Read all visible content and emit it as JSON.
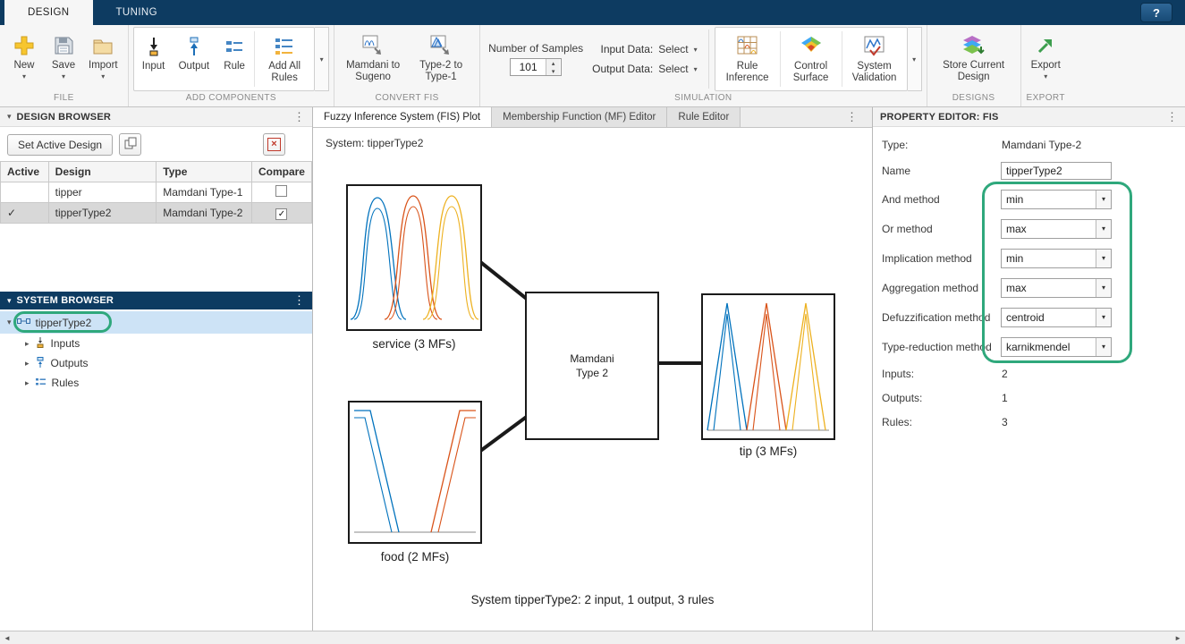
{
  "colors": {
    "titlebar_blue": "#0d3b61",
    "annotation_green": "#2fa87c",
    "mf_blue": "#0072BD",
    "mf_orange": "#D95319",
    "mf_yellow": "#EDB120"
  },
  "icons": {
    "help": "?",
    "caret_down": "▾",
    "overflow_menu": "⋮",
    "collapse_arrow": "▾",
    "expand_arrow": "▸",
    "check": "✓",
    "close": "×",
    "spin_up": "▴",
    "spin_down": "▾",
    "scroll_left": "◄",
    "scroll_right": "►"
  },
  "app_tabs": {
    "design": "DESIGN",
    "tuning": "TUNING"
  },
  "ribbon": {
    "file": {
      "section": "FILE",
      "new": "New",
      "save": "Save",
      "import": "Import"
    },
    "add_components": {
      "section": "ADD COMPONENTS",
      "input": "Input",
      "output": "Output",
      "rule": "Rule",
      "add_all_rules": "Add All Rules"
    },
    "convert": {
      "section": "CONVERT FIS",
      "mamdani_to_sugeno": "Mamdani to Sugeno",
      "type2_to_type1": "Type-2 to Type-1"
    },
    "simulation": {
      "section": "SIMULATION",
      "samples_label": "Number of Samples",
      "samples_value": "101",
      "input_data_label": "Input Data:",
      "input_data_value": "Select",
      "output_data_label": "Output Data:",
      "output_data_value": "Select",
      "rule_inference": "Rule Inference",
      "control_surface": "Control Surface",
      "system_validation": "System Validation"
    },
    "designs": {
      "section": "DESIGNS",
      "store": "Store Current Design"
    },
    "export": {
      "section": "EXPORT",
      "button": "Export"
    }
  },
  "design_browser": {
    "title": "DESIGN BROWSER",
    "set_active": "Set Active Design",
    "columns": {
      "active": "Active",
      "design": "Design",
      "type": "Type",
      "compare": "Compare"
    },
    "rows": [
      {
        "active": "",
        "design": "tipper",
        "type": "Mamdani Type-1",
        "compare": ""
      },
      {
        "active": "✓",
        "design": "tipperType2",
        "type": "Mamdani Type-2",
        "compare": "✓"
      }
    ]
  },
  "system_browser": {
    "title": "SYSTEM BROWSER",
    "root": "tipperType2",
    "children": [
      "Inputs",
      "Outputs",
      "Rules"
    ]
  },
  "document": {
    "tabs": [
      "Fuzzy Inference System (FIS) Plot",
      "Membership Function (MF) Editor",
      "Rule Editor"
    ],
    "system_label": "System: tipperType2",
    "input1_label": "service (3 MFs)",
    "input2_label": "food (2 MFs)",
    "fis_line1": "Mamdani",
    "fis_line2": "Type 2",
    "output_label": "tip (3 MFs)",
    "caption": "System tipperType2: 2 input, 1 output, 3 rules"
  },
  "property_editor": {
    "title": "PROPERTY EDITOR: FIS",
    "type_label": "Type:",
    "type_value": "Mamdani Type-2",
    "name_label": "Name",
    "name_value": "tipperType2",
    "methods": [
      {
        "label": "And method",
        "value": "min"
      },
      {
        "label": "Or method",
        "value": "max"
      },
      {
        "label": "Implication method",
        "value": "min"
      },
      {
        "label": "Aggregation method",
        "value": "max"
      },
      {
        "label": "Defuzzification method",
        "value": "centroid"
      },
      {
        "label": "Type-reduction method",
        "value": "karnikmendel"
      }
    ],
    "stats": [
      {
        "label": "Inputs:",
        "value": "2"
      },
      {
        "label": "Outputs:",
        "value": "1"
      },
      {
        "label": "Rules:",
        "value": "3"
      }
    ]
  }
}
